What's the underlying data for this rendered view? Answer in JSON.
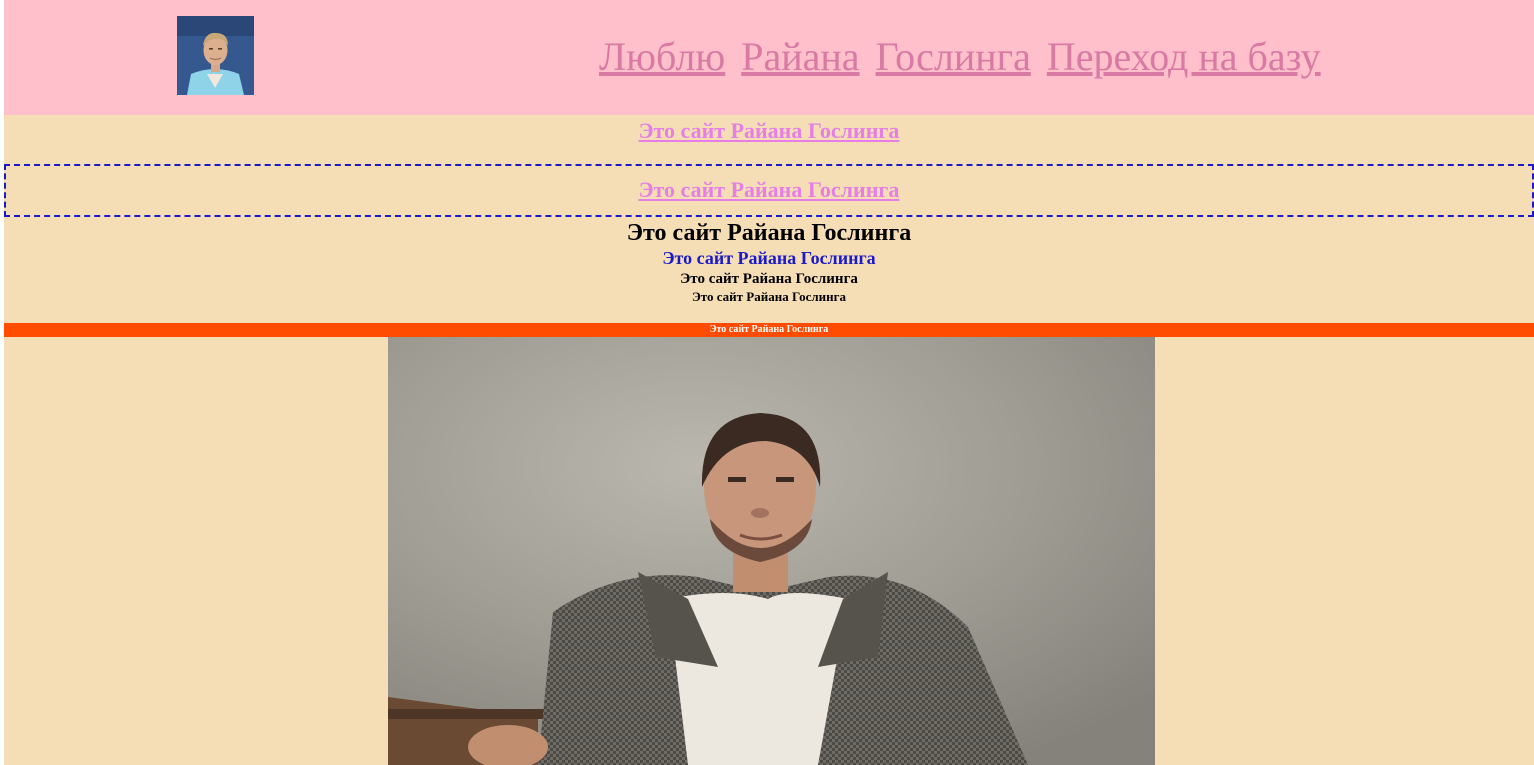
{
  "header": {
    "logo_alt": "Ryan Gosling portrait thumbnail",
    "nav": [
      {
        "label": "Люблю"
      },
      {
        "label": "Райана"
      },
      {
        "label": "Гослинга"
      },
      {
        "label": "Переход на базу"
      }
    ]
  },
  "content": {
    "lines": [
      "Это сайт Райана Гослинга",
      "Это сайт Райана Гослинга",
      "Это сайт Райана Гослинга",
      "Это сайт Райана Гослинга",
      "Это сайт Райана Гослинга",
      "Это сайт Райана Гослинга",
      "Это сайт Райана Гослинга"
    ],
    "photo_alt": "Ryan Gosling sitting against a concrete wall"
  },
  "colors": {
    "header_bg": "#ffbfcb",
    "page_bg": "#f5ddb5",
    "nav_link": "#d87aa3",
    "pink_link": "#e57fe6",
    "dashed_border": "#1a1ac8",
    "blue_heading": "#1a1ac8",
    "orange_bar": "#ff4c00"
  }
}
